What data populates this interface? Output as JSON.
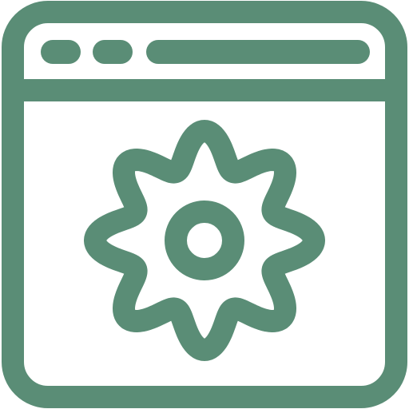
{
  "icon": {
    "name": "browser-settings-icon",
    "parts": [
      "window-frame-icon",
      "title-bar-dots-icon",
      "address-bar-icon",
      "gear-icon"
    ]
  },
  "colors": {
    "stroke": "#5a8d76",
    "background": "#ffffff"
  }
}
